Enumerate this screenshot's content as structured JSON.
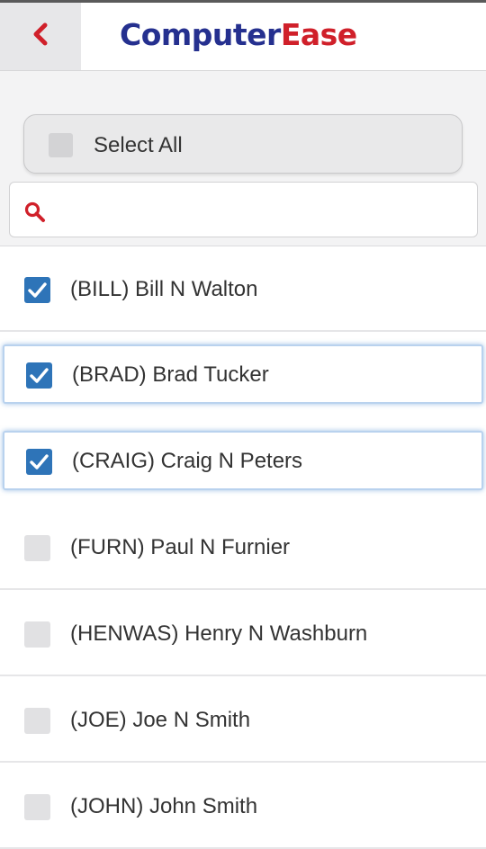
{
  "header": {
    "logo_part1": "Computer",
    "logo_part2": "Ease",
    "colors": {
      "logo_primary": "#25308f",
      "logo_accent": "#d0202a",
      "back_arrow": "#d0202a"
    }
  },
  "select_all": {
    "label": "Select All",
    "checked": false
  },
  "search": {
    "value": "",
    "placeholder": ""
  },
  "employees": [
    {
      "label": "(BILL) Bill N Walton",
      "checked": true
    },
    {
      "label": "(BRAD) Brad Tucker",
      "checked": true
    },
    {
      "label": "(CRAIG) Craig N Peters",
      "checked": true
    },
    {
      "label": "(FURN) Paul N Furnier",
      "checked": false
    },
    {
      "label": "(HENWAS) Henry N Washburn",
      "checked": false
    },
    {
      "label": "(JOE) Joe N Smith",
      "checked": false
    },
    {
      "label": "(JOHN) John Smith",
      "checked": false
    }
  ],
  "colors": {
    "checkbox_checked": "#2e74b8",
    "checkbox_unchecked": "#e1e1e3",
    "focus_glow": "#b9d2ee"
  }
}
